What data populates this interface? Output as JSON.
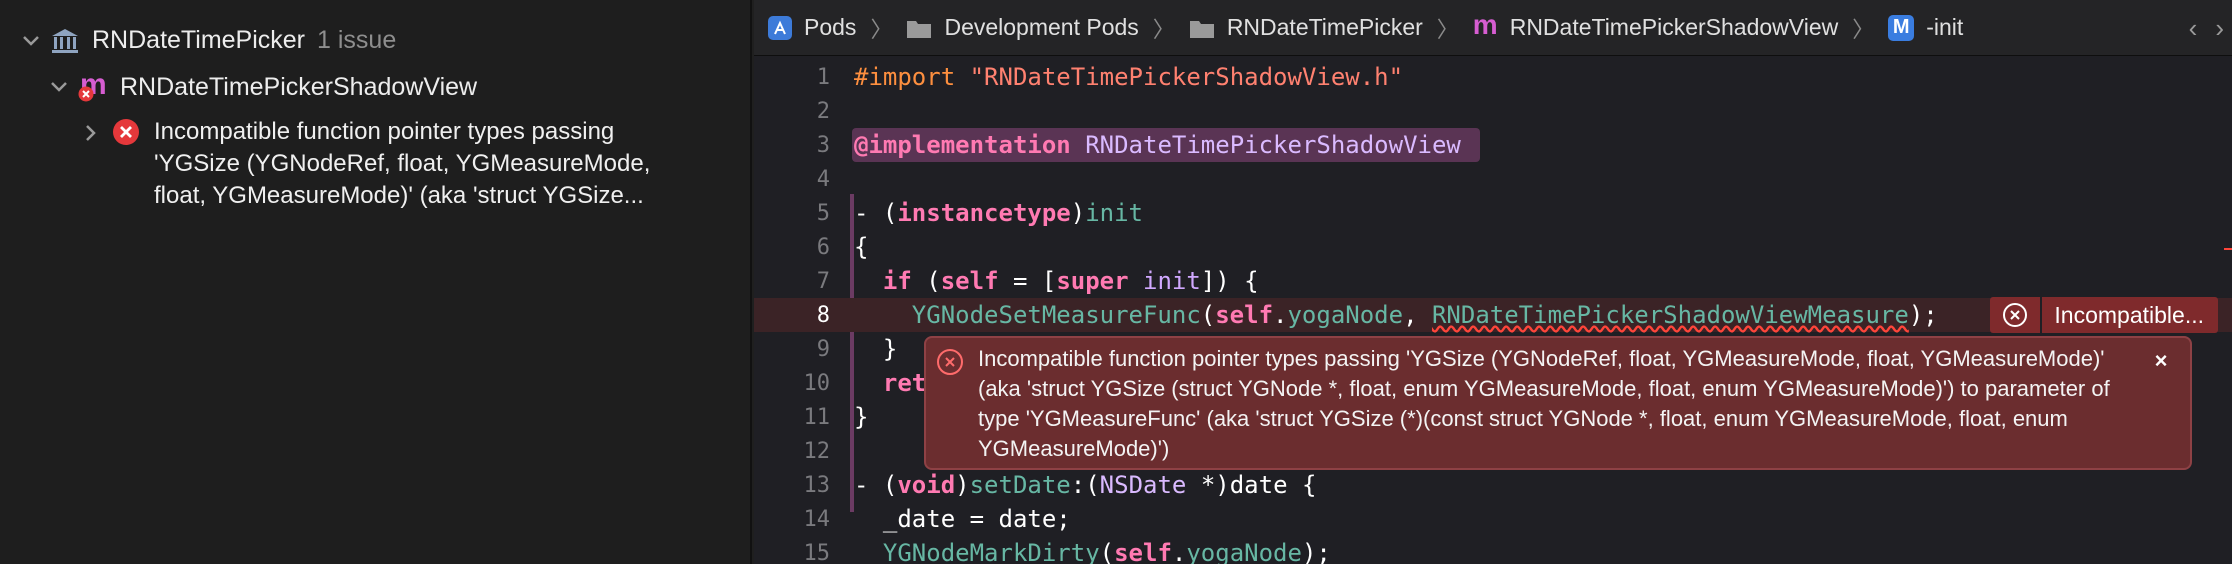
{
  "navigator": {
    "project": {
      "name": "RNDateTimePicker",
      "issue_count": "1 issue"
    },
    "file": {
      "name": "RNDateTimePickerShadowView",
      "icon_letter": "m"
    },
    "issue": {
      "text": "Incompatible function pointer types passing\n'YGSize (YGNodeRef, float, YGMeasureMode,\nfloat, YGMeasureMode)' (aka 'struct YGSize..."
    }
  },
  "jumpbar": {
    "crumbs": [
      {
        "label": "Pods",
        "icon": "app-store-icon"
      },
      {
        "label": "Development Pods",
        "icon": "folder-icon"
      },
      {
        "label": "RNDateTimePicker",
        "icon": "folder-icon"
      },
      {
        "label": "RNDateTimePickerShadowView",
        "icon": "m-file-icon"
      },
      {
        "label": "-init",
        "icon": "method-icon",
        "icon_letter": "M"
      }
    ]
  },
  "code": {
    "line_numbers": [
      "1",
      "2",
      "3",
      "4",
      "5",
      "6",
      "7",
      "8",
      "9",
      "10",
      "11",
      "12",
      "13",
      "14",
      "15"
    ],
    "l1_pre": "#import",
    "l1_str": " \"RNDateTimePickerShadowView.h\"",
    "l3_kw": "@implementation",
    "l3_name": " RNDateTimePickerShadowView",
    "l5_a": "- (",
    "l5_kw": "instancetype",
    "l5_b": ")",
    "l5_fn": "init",
    "l6": "{",
    "l7_a": "  ",
    "l7_if": "if",
    "l7_b": " (",
    "l7_self": "self",
    "l7_c": " = [",
    "l7_super": "super",
    "l7_d": " ",
    "l7_init": "init",
    "l7_e": "]) {",
    "l8_a": "    ",
    "l8_fn": "YGNodeSetMeasureFunc",
    "l8_b": "(",
    "l8_self": "self",
    "l8_c": ".",
    "l8_prop": "yogaNode",
    "l8_d": ", ",
    "l8_arg": "RNDateTimePickerShadowViewMeasure",
    "l8_e": ");",
    "l9": "  }",
    "l10_kw": "  ret",
    "l11": "}",
    "l13_a": "- (",
    "l13_kw": "void",
    "l13_b": ")",
    "l13_fn": "setDate",
    "l13_c": ":(",
    "l13_type": "NSDate",
    "l13_d": " *)date {",
    "l14": "  _date = date;",
    "l15_a": "  ",
    "l15_fn": "YGNodeMarkDirty",
    "l15_b": "(",
    "l15_self": "self",
    "l15_c": ".",
    "l15_prop": "yogaNode",
    "l15_d": ");"
  },
  "inline_error": {
    "label": "Incompatible..."
  },
  "popover": {
    "message": "Incompatible function pointer types passing 'YGSize (YGNodeRef, float, YGMeasureMode, float, YGMeasureMode)' (aka 'struct YGSize (struct YGNode *, float, enum YGMeasureMode, float, enum YGMeasureMode)') to parameter of type 'YGMeasureFunc' (aka 'struct YGSize (*)(const struct YGNode *, float, enum YGMeasureMode, float, enum YGMeasureMode)')",
    "close": "×"
  },
  "colors": {
    "error": "#ff453a",
    "popover_bg": "#6b2d2f",
    "impl_highlight": "#5a3454"
  }
}
